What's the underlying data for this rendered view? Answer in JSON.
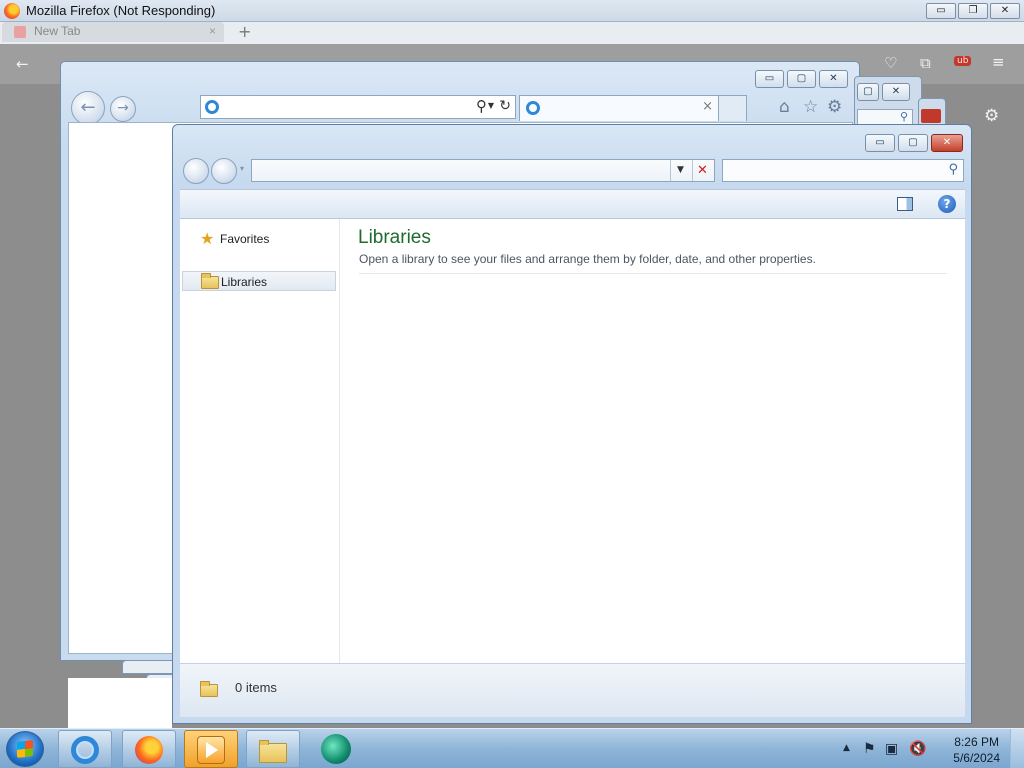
{
  "firefox": {
    "title": "Mozilla Firefox (Not Responding)",
    "tab_label": "New Tab",
    "new_tab_glyph": "+",
    "tab_close_glyph": "×",
    "minimize_glyph": "▭",
    "restore_glyph": "❐",
    "close_glyph": "✕",
    "addon_badge": "ub"
  },
  "ie": {
    "address_value": "",
    "tab_label": "",
    "tab_close_glyph": "×",
    "minimize_glyph": "▭",
    "maximize_glyph": "▢",
    "close_glyph": "✕"
  },
  "explorer": {
    "address_value": "",
    "search_placeholder": "",
    "minimize_glyph": "▭",
    "maximize_glyph": "▢",
    "close_glyph": "✕",
    "nav": {
      "favorites": "Favorites",
      "libraries": "Libraries"
    },
    "content": {
      "title": "Libraries",
      "description": "Open a library to see your files and arrange them by folder, date, and other properties."
    },
    "status": {
      "items_text": "0 items"
    },
    "help_glyph": "?"
  },
  "taskbar": {
    "apps": [
      {
        "name": "internet-explorer",
        "active": false
      },
      {
        "name": "firefox",
        "active": false
      },
      {
        "name": "media-player",
        "active": true
      },
      {
        "name": "windows-explorer",
        "active": false
      },
      {
        "name": "app-teal-circle",
        "active": false
      }
    ],
    "tray": {
      "time": "8:26 PM",
      "date": "5/6/2024"
    }
  },
  "colors": {
    "libraries_title": "#1e6b2e",
    "close_red": "#cc1f1f",
    "help_blue": "#1c5cb6"
  }
}
